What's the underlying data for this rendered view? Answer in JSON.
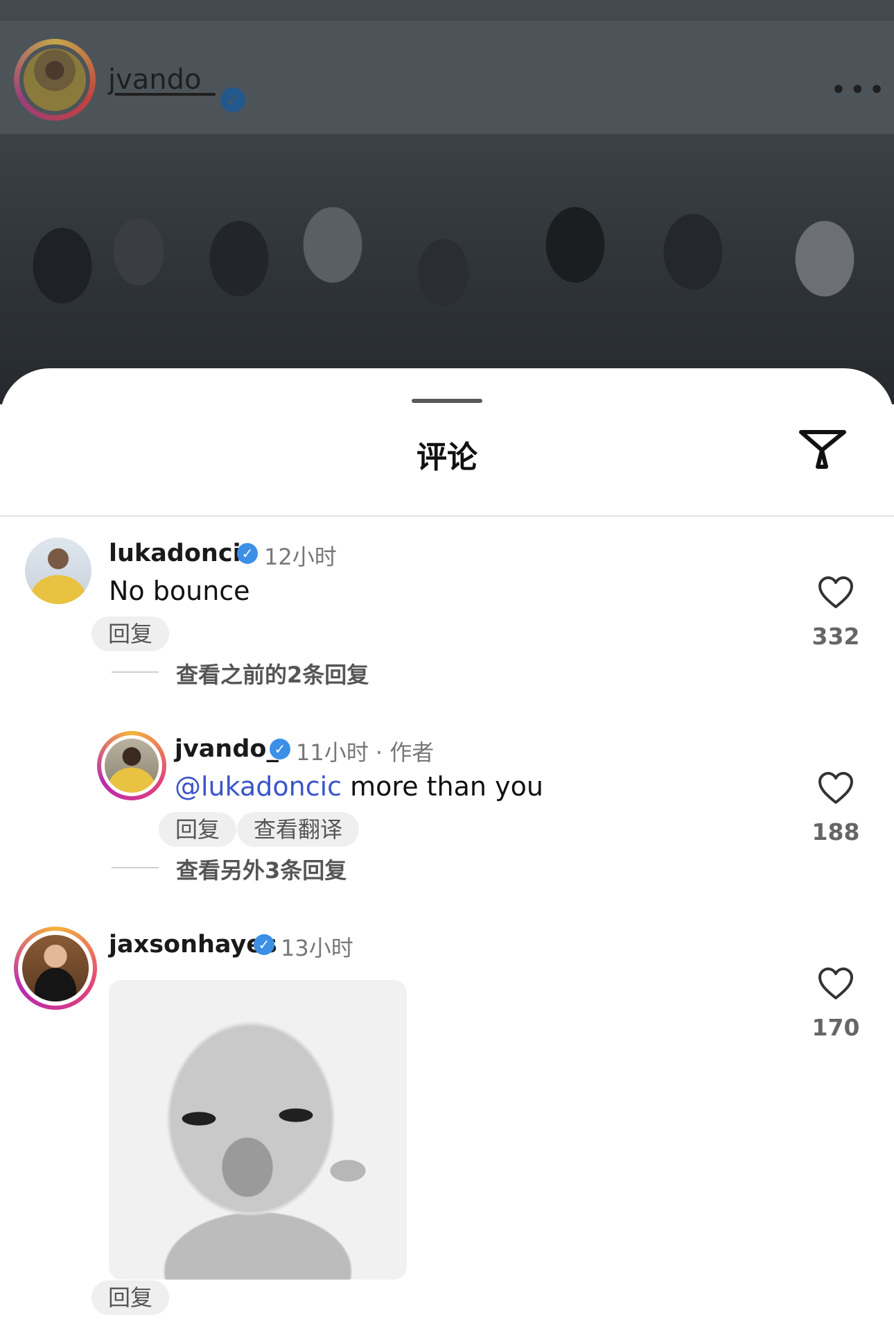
{
  "post": {
    "username": "jvando_",
    "more_label": "•••"
  },
  "sheet": {
    "title": "评论"
  },
  "comments": [
    {
      "username": "lukadoncic",
      "time": "12小时",
      "text": "No bounce",
      "reply_label": "回复",
      "view_replies": "查看之前的2条回复",
      "likes": "332"
    },
    {
      "username": "jvando_",
      "time": "11小时 · 作者",
      "mention": "@lukadoncic",
      "text": " more than you",
      "reply_label": "回复",
      "translate_label": "查看翻译",
      "view_replies": "查看另外3条回复",
      "likes": "188"
    },
    {
      "username": "jaxsonhayes",
      "time": "13小时",
      "reply_label": "回复",
      "likes": "170"
    }
  ],
  "colors": {
    "verified": "#3b8fe6",
    "mention": "#3b55c9",
    "story_ring": "#e0417a"
  },
  "icons": {
    "verified": "verified-badge-icon",
    "heart": "heart-icon",
    "filter": "filter-icon",
    "more": "more-icon"
  }
}
